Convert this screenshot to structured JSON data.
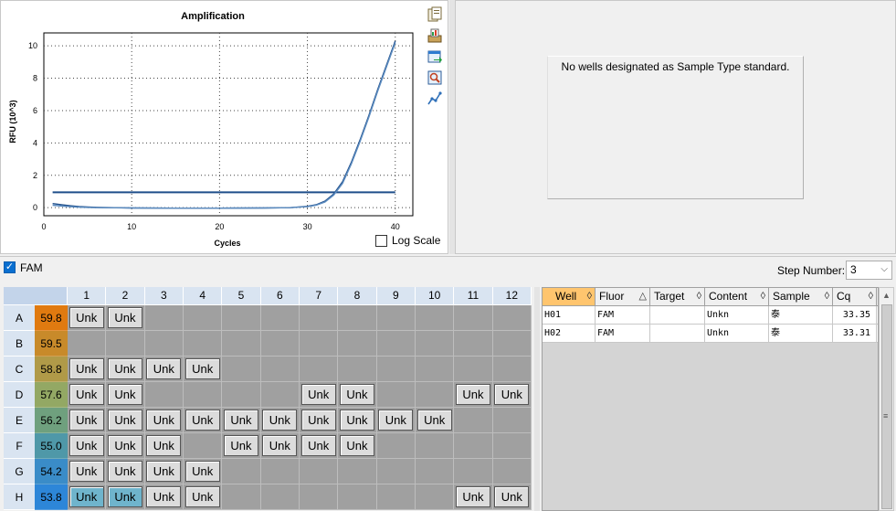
{
  "chart": {
    "title": "Amplification",
    "xlabel": "Cycles",
    "ylabel": "RFU (10^3)",
    "log_scale_label": "Log Scale"
  },
  "chart_data": {
    "type": "line",
    "title": "Amplification",
    "xlabel": "Cycles",
    "ylabel": "RFU (10^3)",
    "xlim": [
      0,
      42
    ],
    "ylim": [
      -0.5,
      10.8
    ],
    "x_ticks": [
      0,
      10,
      20,
      30,
      40
    ],
    "y_ticks": [
      0,
      2,
      4,
      6,
      8,
      10
    ],
    "grid": true,
    "series": [
      {
        "x": [
          1,
          2,
          3,
          4,
          5,
          6,
          8,
          10,
          15,
          20,
          25,
          28,
          30,
          31,
          32,
          33,
          34,
          35,
          36,
          37,
          38,
          39,
          40
        ],
        "y": [
          0.25,
          0.18,
          0.12,
          0.07,
          0.04,
          0.02,
          0.0,
          -0.02,
          -0.03,
          -0.03,
          -0.02,
          0.0,
          0.08,
          0.18,
          0.4,
          0.85,
          1.6,
          2.8,
          4.2,
          5.7,
          7.3,
          8.8,
          10.3
        ],
        "color": "#1f4e8a"
      },
      {
        "x": [
          1,
          2,
          3,
          4,
          5,
          6,
          8,
          10,
          15,
          20,
          25,
          28,
          30,
          31,
          32,
          33,
          34,
          35,
          36,
          37,
          38,
          39,
          40
        ],
        "y": [
          0.15,
          0.1,
          0.06,
          0.03,
          0.01,
          0.0,
          -0.01,
          -0.02,
          -0.03,
          -0.03,
          -0.02,
          0.0,
          0.06,
          0.15,
          0.35,
          0.78,
          1.5,
          2.7,
          4.1,
          5.6,
          7.2,
          8.7,
          10.2
        ],
        "color": "#5c8cc0"
      }
    ],
    "threshold": {
      "y": 0.95,
      "x_range": [
        1,
        40
      ],
      "color": "#1f4e8a"
    }
  },
  "standard_curve": {
    "message": "No wells designated as Sample Type standard."
  },
  "fluor": {
    "label": "FAM",
    "checked": true,
    "step_label": "Step Number:",
    "step_value": "3"
  },
  "plate": {
    "columns": [
      "1",
      "2",
      "3",
      "4",
      "5",
      "6",
      "7",
      "8",
      "9",
      "10",
      "11",
      "12"
    ],
    "rows": [
      {
        "label": "A",
        "temp": "59.8",
        "color": "#e07a10",
        "wells": [
          "Unk",
          "Unk",
          "",
          "",
          "",
          "",
          "",
          "",
          "",
          "",
          "",
          ""
        ]
      },
      {
        "label": "B",
        "temp": "59.5",
        "color": "#c88a2a",
        "wells": [
          "",
          "",
          "",
          "",
          "",
          "",
          "",
          "",
          "",
          "",
          "",
          ""
        ]
      },
      {
        "label": "C",
        "temp": "58.8",
        "color": "#b09a48",
        "wells": [
          "Unk",
          "Unk",
          "Unk",
          "Unk",
          "",
          "",
          "",
          "",
          "",
          "",
          "",
          ""
        ]
      },
      {
        "label": "D",
        "temp": "57.6",
        "color": "#93a864",
        "wells": [
          "Unk",
          "Unk",
          "",
          "",
          "",
          "",
          "Unk",
          "Unk",
          "",
          "",
          "Unk",
          "Unk"
        ]
      },
      {
        "label": "E",
        "temp": "56.2",
        "color": "#6fa07e",
        "wells": [
          "Unk",
          "Unk",
          "Unk",
          "Unk",
          "Unk",
          "Unk",
          "Unk",
          "Unk",
          "Unk",
          "Unk",
          "",
          ""
        ]
      },
      {
        "label": "F",
        "temp": "55.0",
        "color": "#4f98a8",
        "wells": [
          "Unk",
          "Unk",
          "Unk",
          "",
          "Unk",
          "Unk",
          "Unk",
          "Unk",
          "",
          "",
          "",
          ""
        ]
      },
      {
        "label": "G",
        "temp": "54.2",
        "color": "#3a8cc8",
        "wells": [
          "Unk",
          "Unk",
          "Unk",
          "Unk",
          "",
          "",
          "",
          "",
          "",
          "",
          "",
          ""
        ]
      },
      {
        "label": "H",
        "temp": "53.8",
        "color": "#2d86d8",
        "wells": [
          "Unk",
          "Unk",
          "Unk",
          "Unk",
          "",
          "",
          "",
          "",
          "",
          "",
          "Unk",
          "Unk"
        ]
      }
    ],
    "selected": [
      "H1",
      "H2"
    ]
  },
  "table": {
    "headers": [
      "Well",
      "Fluor",
      "Target",
      "Content",
      "Sample",
      "Cq"
    ],
    "rows": [
      [
        "H01",
        "FAM",
        "",
        "Unkn",
        "泰",
        "33.35"
      ],
      [
        "H02",
        "FAM",
        "",
        "Unkn",
        "泰",
        "33.31"
      ]
    ]
  },
  "colors": {
    "accent": "#ffc56e",
    "selection": "#6fb4cc"
  }
}
